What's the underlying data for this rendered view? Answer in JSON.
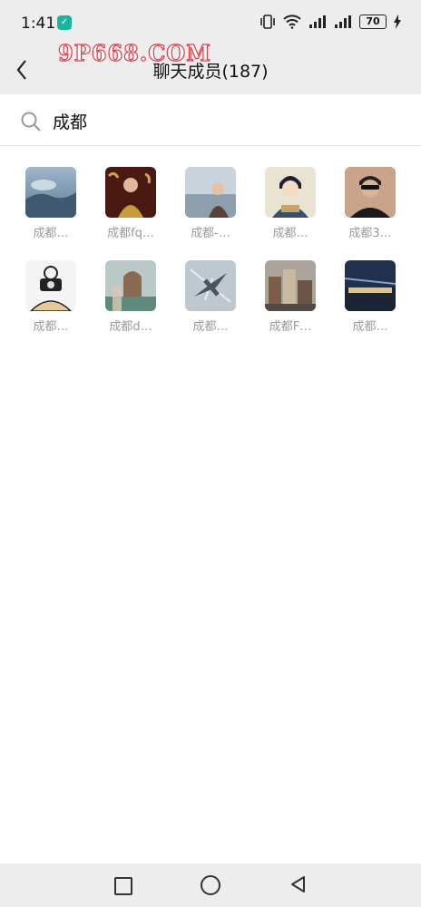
{
  "status": {
    "time": "1:41",
    "battery": "70"
  },
  "watermark": "9P668.COM",
  "header": {
    "title": "聊天成员(187)"
  },
  "search": {
    "value": "成都"
  },
  "members": [
    {
      "name": "成都…"
    },
    {
      "name": "成都fq…"
    },
    {
      "name": "成都-…"
    },
    {
      "name": "成都…"
    },
    {
      "name": "成都3…"
    },
    {
      "name": "成都…"
    },
    {
      "name": "成都d…"
    },
    {
      "name": "成都…"
    },
    {
      "name": "成都F…"
    },
    {
      "name": "成都…"
    }
  ]
}
